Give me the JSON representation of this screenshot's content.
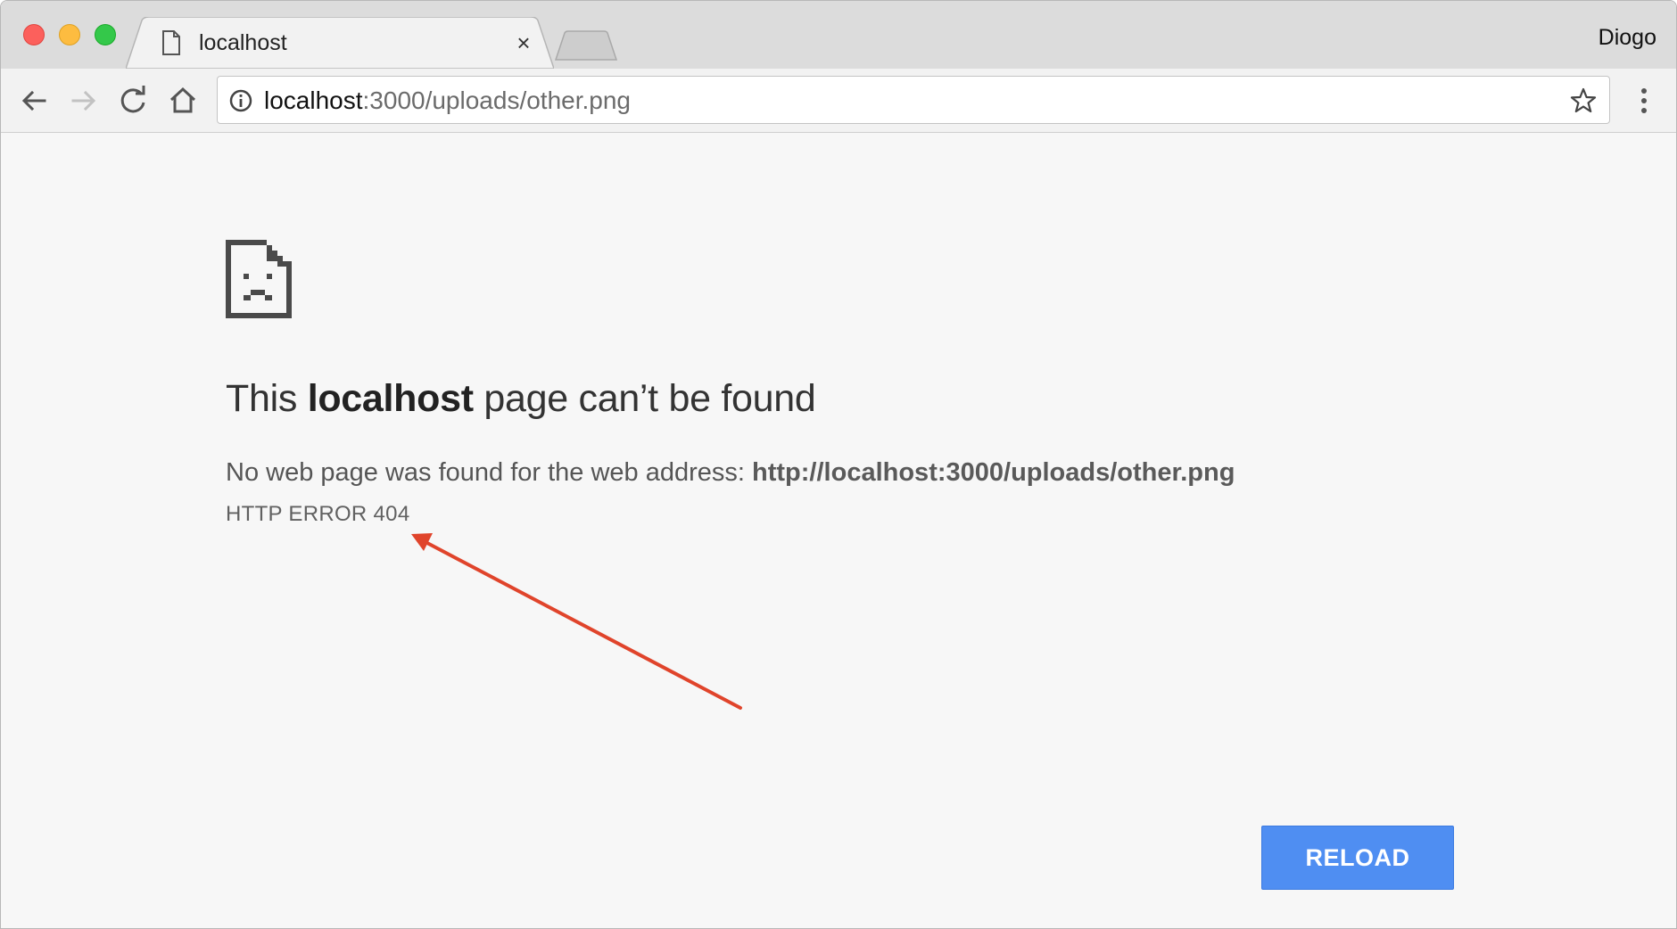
{
  "window": {
    "profile_name": "Diogo"
  },
  "tab": {
    "title": "localhost",
    "close_glyph": "×"
  },
  "omnibox": {
    "url_host": "localhost",
    "url_rest": ":3000/uploads/other.png"
  },
  "error_page": {
    "headline_pre": "This ",
    "headline_host": "localhost",
    "headline_post": " page can’t be found",
    "description_prefix": "No web page was found for the web address: ",
    "description_url": "http://localhost:3000/uploads/other.png",
    "error_code": "HTTP ERROR 404",
    "reload_label": "RELOAD"
  },
  "icons": {
    "traffic_lights": [
      "close-window-icon",
      "minimize-window-icon",
      "zoom-window-icon"
    ],
    "tab_favicon": "document-icon",
    "back": "back-arrow-icon",
    "forward": "forward-arrow-icon",
    "reload": "reload-icon",
    "home": "home-icon",
    "site_info": "info-icon",
    "bookmark": "star-icon",
    "menu": "kebab-menu-icon",
    "page": "sad-page-icon",
    "annotation": "red-arrow-annotation"
  },
  "colors": {
    "reload_button": "#4f8ef2",
    "annotation_arrow": "#e0442b",
    "page_background": "#f7f7f7"
  }
}
